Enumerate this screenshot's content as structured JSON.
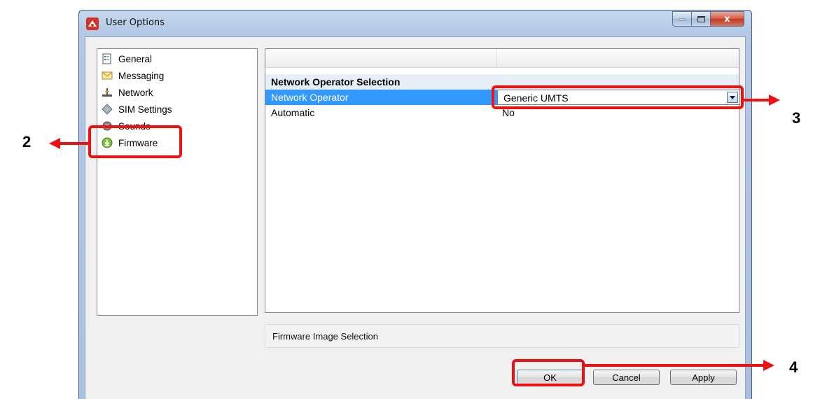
{
  "window": {
    "title": "User Options",
    "close_glyph": "x"
  },
  "tree": {
    "items": [
      {
        "label": "General",
        "icon": "general-icon"
      },
      {
        "label": "Messaging",
        "icon": "envelope-icon"
      },
      {
        "label": "Network",
        "icon": "network-icon"
      },
      {
        "label": "SIM Settings",
        "icon": "sim-card-icon"
      },
      {
        "label": "Sounds",
        "icon": "speaker-icon"
      },
      {
        "label": "Firmware",
        "icon": "download-icon"
      }
    ]
  },
  "grid": {
    "group_label": "Network Operator Selection",
    "rows": [
      {
        "label": "Network Operator",
        "value": "Generic UMTS"
      },
      {
        "label": "Automatic",
        "value": "No"
      }
    ]
  },
  "description": "Firmware Image Selection",
  "buttons": {
    "ok": "OK",
    "cancel": "Cancel",
    "apply": "Apply"
  },
  "callouts": {
    "firmware": "2",
    "combo": "3",
    "ok": "4"
  },
  "colors": {
    "highlight": "#ee1111",
    "selection": "#3399ff",
    "group_row": "#e7eef8"
  }
}
